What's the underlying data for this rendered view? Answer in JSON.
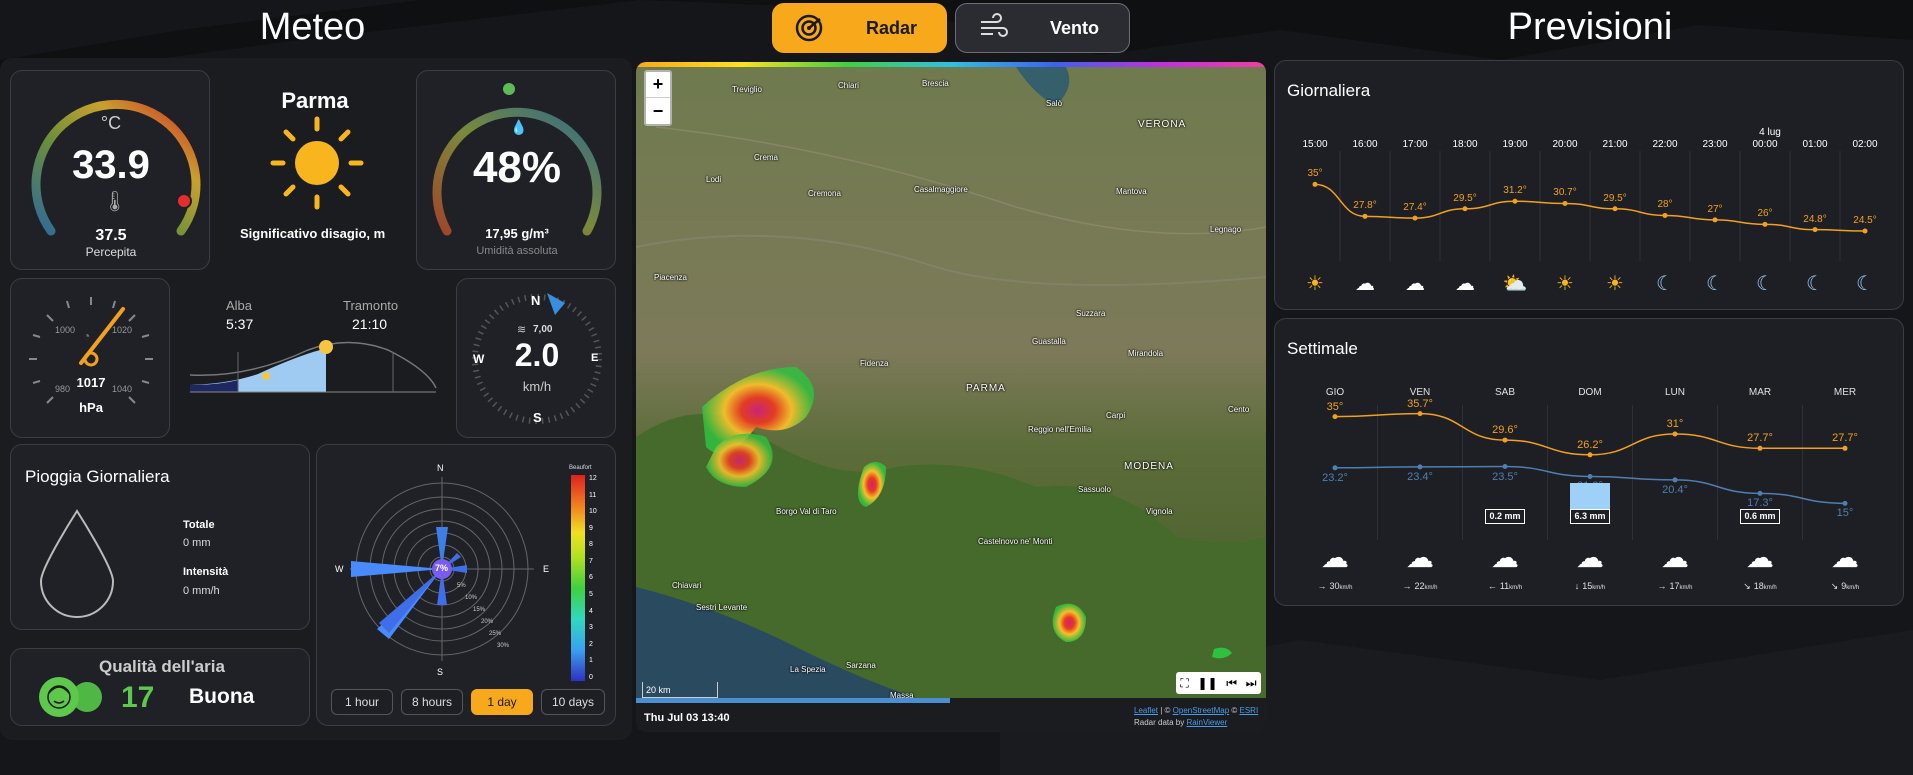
{
  "headers": {
    "meteo": "Meteo",
    "previsioni": "Previsioni"
  },
  "tabs": [
    {
      "label": "Radar",
      "active": true,
      "icon": "radar-icon"
    },
    {
      "label": "Vento",
      "active": false,
      "icon": "wind-icon"
    }
  ],
  "temperature": {
    "unit": "°C",
    "value": "33.9",
    "perceived": "37.5",
    "perceived_label": "Percepita"
  },
  "location": {
    "city": "Parma",
    "condition_text": "Significativo disagio, m",
    "icon": "sun-icon"
  },
  "humidity": {
    "value": "48%",
    "absolute": "17,95 g/m³",
    "absolute_label": "Umidità assoluta"
  },
  "pressure": {
    "value": "1017",
    "unit": "hPa",
    "ticks": [
      "980",
      "1000",
      "1020",
      "1040"
    ]
  },
  "sun": {
    "dawn_label": "Alba",
    "dawn": "5:37",
    "sunset_label": "Tramonto",
    "sunset": "21:10"
  },
  "wind": {
    "speed": "2.0",
    "unit": "km/h",
    "gust": "7,00",
    "dirs": [
      "N",
      "E",
      "S",
      "W"
    ]
  },
  "rain": {
    "title": "Pioggia Giornaliera",
    "total_label": "Totale",
    "total": "0 mm",
    "intensity_label": "Intensità",
    "intensity": "0 mm/h"
  },
  "windrose": {
    "center": "7%",
    "dirs": [
      "N",
      "E",
      "S",
      "W"
    ],
    "rings": [
      "5%",
      "10%",
      "15%",
      "20%",
      "25%",
      "30%"
    ],
    "scale_title": "Beaufort",
    "scale": [
      "12",
      "11",
      "10",
      "9",
      "8",
      "7",
      "6",
      "5",
      "4",
      "3",
      "2",
      "1",
      "0"
    ],
    "buttons": [
      "1 hour",
      "8 hours",
      "1 day",
      "10 days"
    ],
    "active_button": "1 day"
  },
  "air": {
    "title": "Qualità dell'aria",
    "value": "17",
    "status": "Buona",
    "color": "#5dc84b"
  },
  "map": {
    "timestamp": "Thu Jul 03 13:40",
    "scale": "20 km",
    "attr_leaflet": "Leaflet",
    "attr_osm": "OpenStreetMap",
    "attr_esri": "ESRI",
    "attr_radar": "Radar data by",
    "attr_rv": "RainViewer",
    "zoom_in": "+",
    "zoom_out": "−",
    "places": [
      {
        "name": "Treviglio"
      },
      {
        "name": "Chiari"
      },
      {
        "name": "Brescia"
      },
      {
        "name": "Salò"
      },
      {
        "name": "VERONA"
      },
      {
        "name": "Lodi"
      },
      {
        "name": "Crema"
      },
      {
        "name": "Cremona"
      },
      {
        "name": "Casalmaggiore"
      },
      {
        "name": "Mantova"
      },
      {
        "name": "PARMA"
      },
      {
        "name": "Fidenza"
      },
      {
        "name": "Reggio nell'Emilia"
      },
      {
        "name": "MODENA"
      },
      {
        "name": "Carpi"
      },
      {
        "name": "Sassuolo"
      },
      {
        "name": "Vignola"
      },
      {
        "name": "Piacenza"
      },
      {
        "name": "Borgo Val di Taro"
      },
      {
        "name": "La Spezia"
      },
      {
        "name": "Sarzana"
      },
      {
        "name": "Massa"
      },
      {
        "name": "Sestri Levante"
      },
      {
        "name": "Chiavari"
      },
      {
        "name": "Castelnovo ne' Monti"
      },
      {
        "name": "Legnago"
      },
      {
        "name": "Guastalla"
      },
      {
        "name": "Suzzara"
      },
      {
        "name": "Mirandola"
      },
      {
        "name": "Cento"
      }
    ]
  },
  "daily_forecast": {
    "title": "Giornaliera",
    "hours": [
      "15:00",
      "16:00",
      "17:00",
      "18:00",
      "19:00",
      "20:00",
      "21:00",
      "22:00",
      "23:00",
      "00:00",
      "01:00",
      "02:00"
    ],
    "date_marker": "4 lug",
    "temps": [
      "35°",
      "27.8°",
      "27.4°",
      "29.5°",
      "31.2°",
      "30.7°",
      "29.5°",
      "28°",
      "27°",
      "26°",
      "24.8°",
      "24.5°"
    ],
    "temp_values": [
      35,
      27.8,
      27.4,
      29.5,
      31.2,
      30.7,
      29.5,
      28,
      27,
      26,
      24.8,
      24.5
    ],
    "icons": [
      "sun-icon",
      "cloud-icon",
      "cloud-icon",
      "cloud-icon",
      "sun-cloud-icon",
      "sun-icon",
      "sun-icon",
      "moon-icon",
      "moon-icon",
      "moon-icon",
      "moon-icon",
      "moon-icon"
    ]
  },
  "weekly_forecast": {
    "title": "Settimale",
    "days": [
      "GIO",
      "VEN",
      "SAB",
      "DOM",
      "LUN",
      "MAR",
      "MER"
    ],
    "max": [
      "35°",
      "35.7°",
      "29.6°",
      "26.2°",
      "31°",
      "27.7°",
      "27.7°"
    ],
    "max_values": [
      35,
      35.7,
      29.6,
      26.2,
      31,
      27.7,
      27.7
    ],
    "min": [
      "23.2°",
      "23.4°",
      "23.5°",
      "21.2°",
      "20.4°",
      "17.3°",
      "15°"
    ],
    "min_values": [
      23.2,
      23.4,
      23.5,
      21.2,
      20.4,
      17.3,
      15
    ],
    "rain": [
      "",
      "",
      "0.2 mm",
      "6.3 mm",
      "",
      "0.6 mm",
      ""
    ],
    "wind": [
      "30",
      "22",
      "11",
      "15",
      "17",
      "18",
      "9"
    ],
    "wind_unit": "km/h",
    "wind_arrows": [
      "→",
      "→",
      "←",
      "↓",
      "→",
      "↘",
      "↘"
    ],
    "icons": [
      "cloud-icon",
      "cloud-icon",
      "cloud-icon",
      "cloud-icon",
      "cloud-icon",
      "cloud-icon",
      "cloud-icon"
    ]
  }
}
